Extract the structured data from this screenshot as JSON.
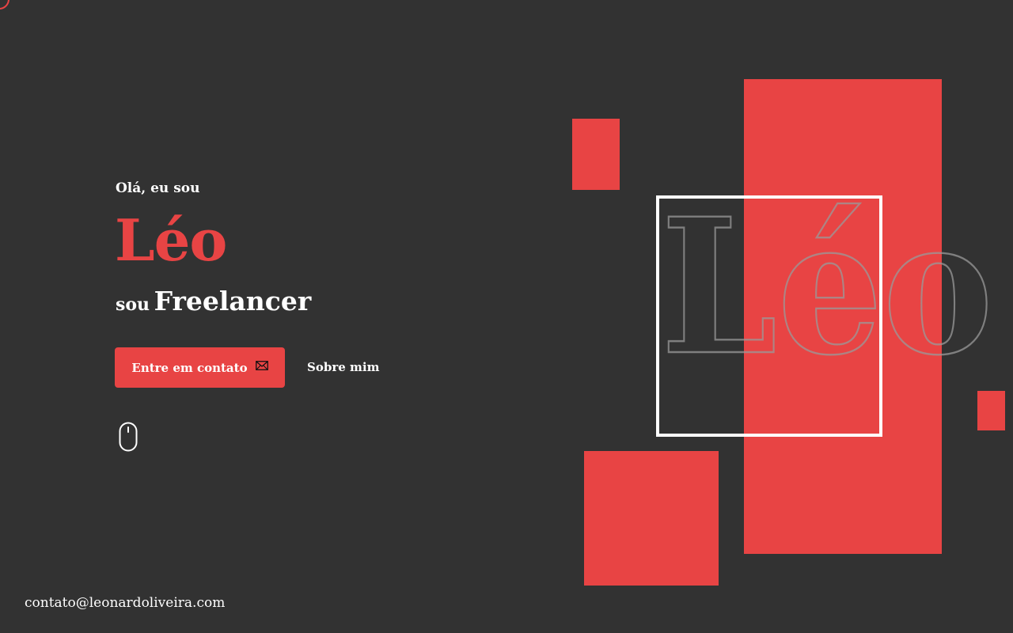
{
  "hero": {
    "greeting": "Olá, eu sou",
    "name": "Léo",
    "role_prefix": "sou",
    "role_title": "Freelancer"
  },
  "actions": {
    "contact_button_label": "Entre em contato",
    "about_link_label": "Sobre mim"
  },
  "footer": {
    "email": "contato@leonardoliveira.com"
  },
  "decoration": {
    "outline_text": "Léo"
  },
  "colors": {
    "background": "#323232",
    "accent": "#e84444",
    "text": "#ffffff"
  },
  "icons": {
    "contact_button_icon": "mail-icon",
    "scroll_hint_icon": "mouse-icon",
    "corner_icon": "circle-icon"
  }
}
